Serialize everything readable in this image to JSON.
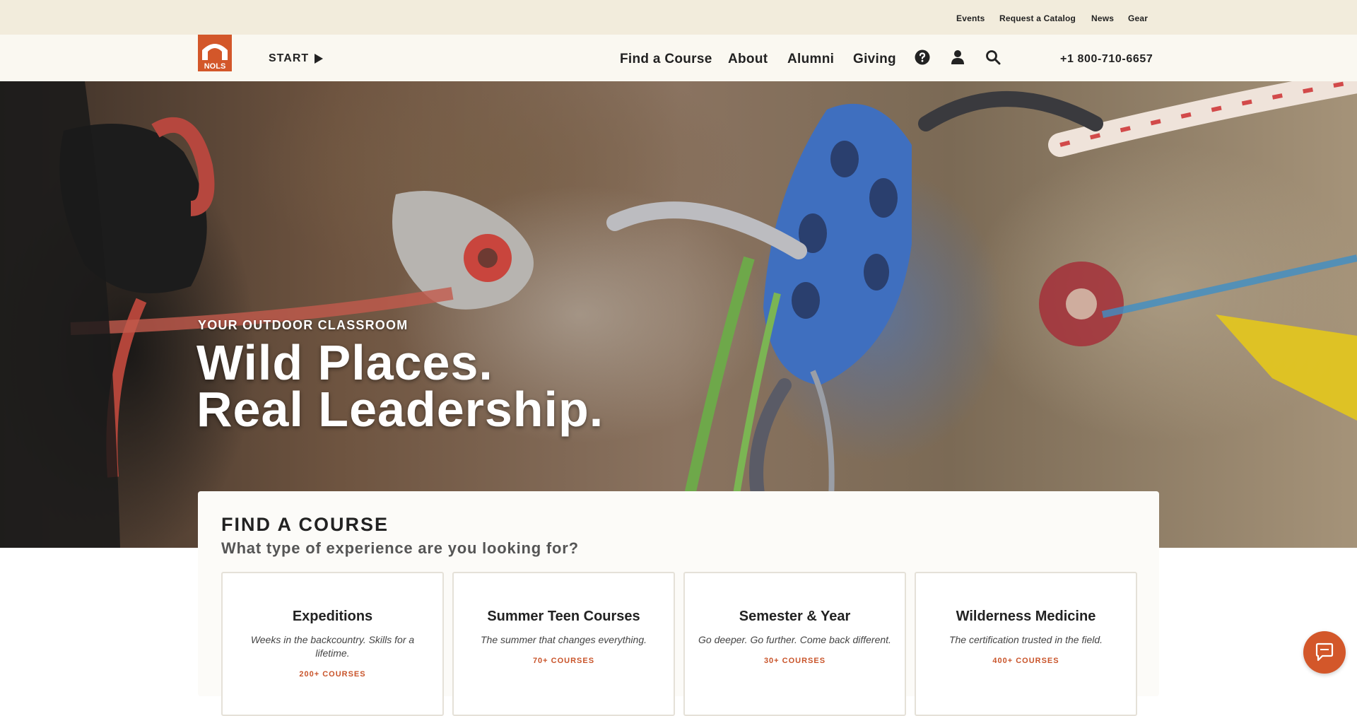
{
  "utility_nav": {
    "events": "Events",
    "catalog": "Request a Catalog",
    "news": "News",
    "gear": "Gear"
  },
  "header": {
    "logo_text": "NOLS",
    "start_label": "START",
    "nav": [
      "Find a Course",
      "About",
      "Alumni",
      "Giving"
    ],
    "icons": [
      "help-icon",
      "user-icon",
      "search-icon"
    ],
    "phone": "+1 800-710-6657"
  },
  "hero": {
    "eyebrow": "YOUR OUTDOOR CLASSROOM",
    "title_line1": "Wild Places.",
    "title_line2": "Real Leadership."
  },
  "finder": {
    "heading": "FIND A COURSE",
    "subheading": "What type of experience are you looking for?",
    "cards": [
      {
        "title": "Expeditions",
        "desc": "Weeks in the backcountry. Skills for a lifetime.",
        "count": "200+ COURSES"
      },
      {
        "title": "Summer Teen Courses",
        "desc": "The summer that changes everything.",
        "count": "70+ COURSES"
      },
      {
        "title": "Semester & Year",
        "desc": "Go deeper. Go further. Come back different.",
        "count": "30+ COURSES"
      },
      {
        "title": "Wilderness Medicine",
        "desc": "The certification trusted in the field.",
        "count": "400+ COURSES"
      }
    ]
  },
  "colors": {
    "accent": "#d3572a",
    "utility_bg": "#f2ecdc",
    "header_bg": "#faf8f1"
  },
  "chat": {
    "icon": "chat-icon"
  }
}
